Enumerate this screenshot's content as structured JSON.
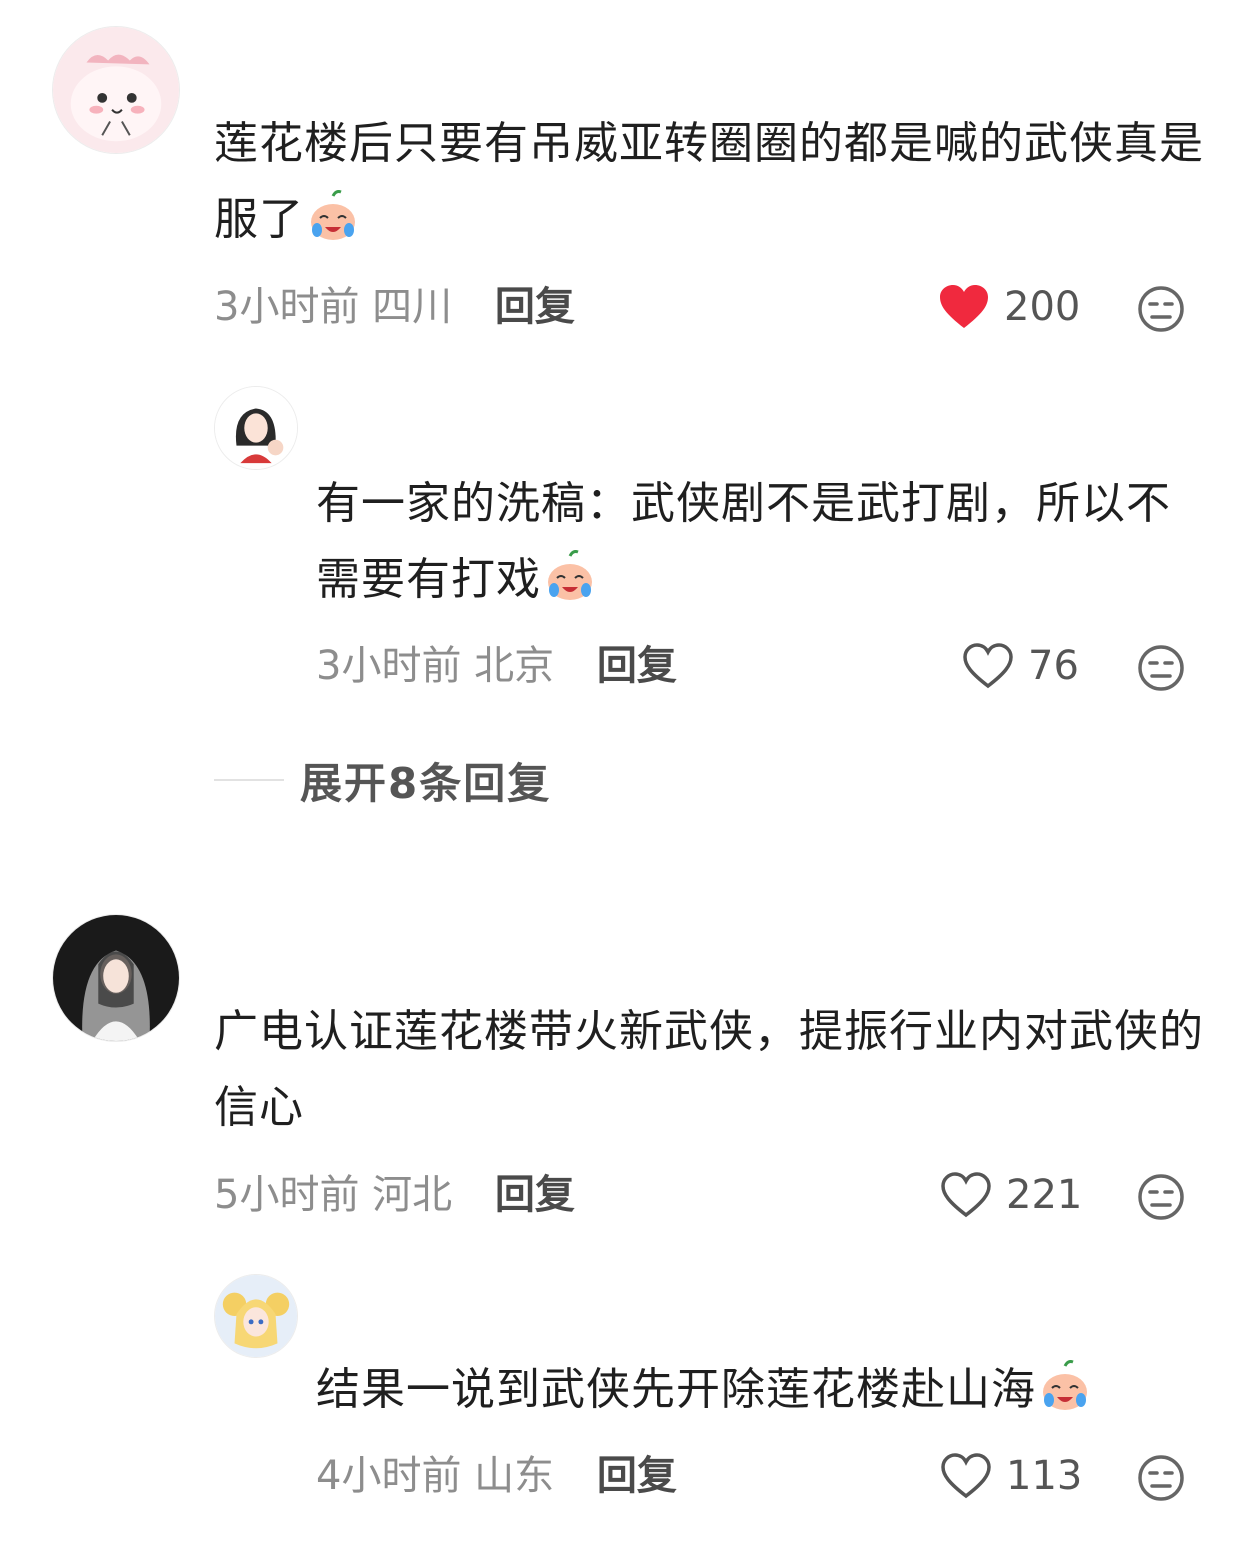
{
  "comments": [
    {
      "text": "莲花楼后只要有吊威亚转圈圈的都是喊的武侠真是服了",
      "time": "3小时前",
      "location": "四川",
      "reply_label": "回复",
      "likes": "200",
      "liked": true
    },
    {
      "text": "有一家的洗稿：武侠剧不是武打剧，所以不需要有打戏",
      "time": "3小时前",
      "location": "北京",
      "reply_label": "回复",
      "likes": "76",
      "liked": false
    },
    {
      "text": "广电认证莲花楼带火新武侠，提振行业内对武侠的信心",
      "time": "5小时前",
      "location": "河北",
      "reply_label": "回复",
      "likes": "221",
      "liked": false
    },
    {
      "text": "结果一说到武侠先开除莲花楼赴山海",
      "time": "4小时前",
      "location": "山东",
      "reply_label": "回复",
      "likes": "113",
      "liked": false
    }
  ],
  "expand_replies": "展开8条回复",
  "icons": {
    "like": "heart-icon",
    "dislike": "meh-face-icon",
    "emoji": "laugh-cry-emoji"
  },
  "colors": {
    "liked_heart": "#f0293e",
    "meta_text": "#8d8d8d",
    "reply_text": "#4a4a4a"
  }
}
